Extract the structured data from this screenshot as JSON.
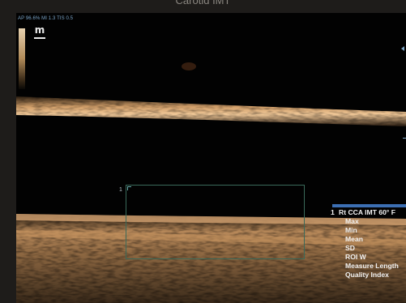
{
  "caption": "Carotid IMT",
  "status_line": "AP 96.6%  MI 1.3  TIS 0.5",
  "icons": {
    "mode": "m-icon"
  },
  "roi": {
    "label": "1"
  },
  "measurements": [
    {
      "index": "1",
      "label": "Rt CCA IMT 60° F"
    },
    {
      "label": "Max"
    },
    {
      "label": "Min"
    },
    {
      "label": "Mean"
    },
    {
      "label": "SD"
    },
    {
      "label": "ROI W"
    },
    {
      "label": "Measure Length"
    },
    {
      "label": "Quality Index"
    }
  ],
  "colors": {
    "accent": "#3c6fb3",
    "tissue": "#c79a62",
    "background": "#020202"
  }
}
